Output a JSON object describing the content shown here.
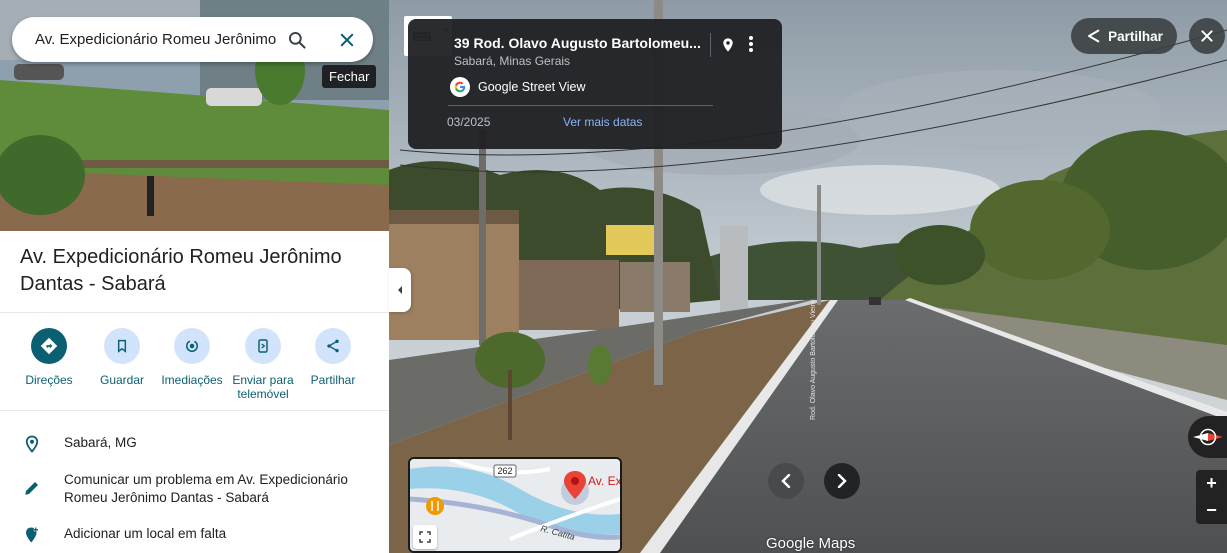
{
  "search": {
    "value": "Av. Expedicionário Romeu Jerônimo",
    "tooltip": "Fechar"
  },
  "place": {
    "title": "Av. Expedicionário Romeu Jerônimo Dantas - Sabará"
  },
  "actions": [
    {
      "label": "Direções",
      "icon": "directions-icon"
    },
    {
      "label": "Guardar",
      "icon": "bookmark-icon"
    },
    {
      "label": "Imediações",
      "icon": "nearby-icon"
    },
    {
      "label": "Enviar para telemóvel",
      "icon": "send-to-phone-icon"
    },
    {
      "label": "Partilhar",
      "icon": "share-icon"
    }
  ],
  "info": [
    {
      "text": "Sabará, MG",
      "icon": "location-pin-icon"
    },
    {
      "text": "Comunicar um problema em Av. Expedicionário Romeu Jerônimo Dantas - Sabará",
      "icon": "pencil-icon"
    },
    {
      "text": "Adicionar um local em falta",
      "icon": "add-location-icon"
    }
  ],
  "streetview": {
    "address": "39 Rod. Olavo Augusto Bartolomeu...",
    "city": "Sabará, Minas Gerais",
    "provider": "Google Street View",
    "date": "03/2025",
    "more_dates": "Ver mais datas",
    "share_label": "Partilhar",
    "logo": "Google Maps",
    "road_sign": "Rod. Olavo Augusto Bartolomeu Vieira"
  },
  "minimap": {
    "route_number": "262",
    "place_label": "Av. Ex Rome",
    "street_label": "R. Catita"
  },
  "colors": {
    "accent": "#0b5f73",
    "accent_light": "#d2e3fc",
    "pin": "#ea4335"
  }
}
